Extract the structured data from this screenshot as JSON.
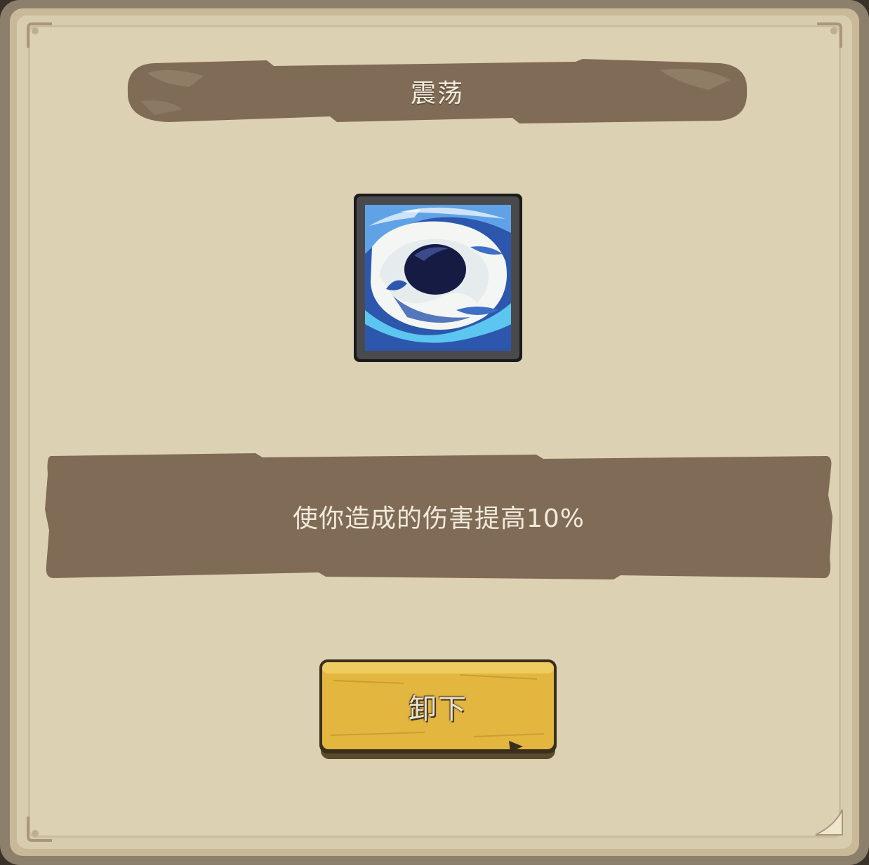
{
  "dialog": {
    "title": "震荡",
    "skill_icon": "shockwave-vortex-icon",
    "description": "使你造成的伤害提高10%",
    "unequip_button_label": "卸下"
  },
  "colors": {
    "panel_border": "#8c7f6b",
    "parchment": "#ddd1b4",
    "banner": "#7f6b56",
    "button_gold": "#e3b63f",
    "icon_blue": "#2c57ad"
  }
}
